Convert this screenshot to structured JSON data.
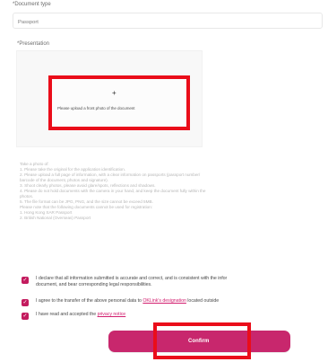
{
  "document_type": {
    "label": "*Document type",
    "value": "Passport"
  },
  "upload": {
    "label": "*Presentation",
    "plus": "+",
    "prompt": "Please upload a front photo of the document"
  },
  "instructions": [
    "Take a photo of:",
    "1. Please take the original for the application identification.",
    "2. Please upload a full page of information, with a clear information on passports (passport number/",
    "barcode of the document, photos and signature).",
    "3. Shoot clearly photos, please avoid glare/spots, reflections and shadows.",
    "4. Please do not hold documents with the camera in your hand, and keep the document fully within the",
    "photos.",
    "5. The file format can be JPG, PNG, and the size cannot be exceed 5MB.",
    "Please note that the following documents cannot be used for registration:",
    "1. Hong Kong SAR Passport",
    "2. British National (Overseas) Passport"
  ],
  "confirmations": [
    {
      "text_1": "I declare that all information submitted is accurate and correct, and is consistent with the infor",
      "text_2": "document, and bear corresponding legal responsibilities."
    },
    {
      "text_before": "I agree to the transfer of the above personal data to ",
      "link": "OKLink's designation",
      "text_after": " located outside"
    },
    {
      "text_before": "I have read and accepted the ",
      "link": "privacy notice",
      "text_after": ""
    }
  ],
  "confirm_button": {
    "label": "Confirm"
  },
  "colors": {
    "accent": "#c8276d",
    "highlight": "#ea0d1a",
    "muted_text": "#b8b8b8"
  }
}
